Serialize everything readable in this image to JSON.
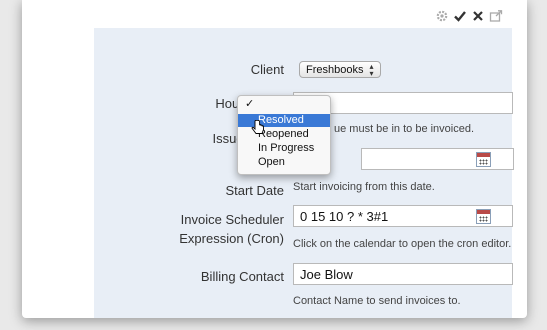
{
  "toolbar": {
    "icons": [
      "gear-icon",
      "check-icon",
      "close-icon",
      "export-icon"
    ]
  },
  "form": {
    "client": {
      "label": "Client",
      "value": "Freshbooks"
    },
    "hourly_rate": {
      "label": "Hourly Rate",
      "value": "700"
    },
    "issue_status": {
      "label": "Issue Status",
      "help_fragment": "ue must be in to be invoiced.",
      "options": [
        "",
        "Resolved",
        "Reopened",
        "In Progress",
        "Open"
      ],
      "selected_mark": "✓",
      "highlighted": "Resolved"
    },
    "start_date": {
      "label": "Start Date",
      "value": "",
      "help": "Start invoicing from this date."
    },
    "invoice_scheduler": {
      "label_line1": "Invoice Scheduler",
      "label_line2": "Expression (Cron)",
      "value": "0 15 10 ? * 3#1",
      "help": "Click on the calendar to open the cron editor."
    },
    "billing_contact": {
      "label": "Billing Contact",
      "value": "Joe Blow",
      "help": "Contact Name to send invoices to."
    }
  }
}
